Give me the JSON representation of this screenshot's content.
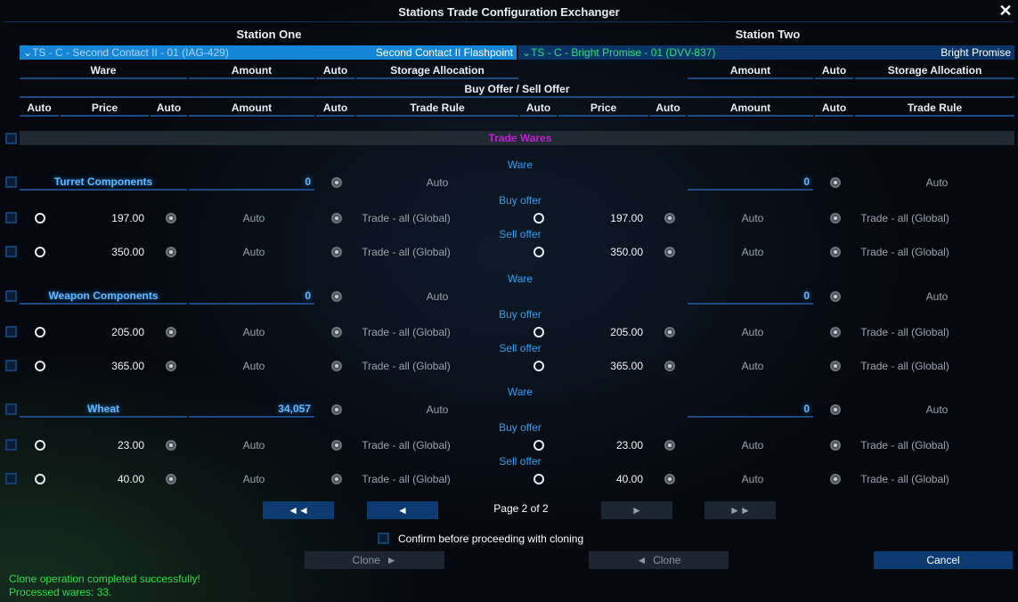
{
  "title": "Stations Trade Configuration Exchanger",
  "close_label": "✕",
  "station_one": {
    "header": "Station One",
    "selected": "TS - C - Second Contact II - 01 (IAG-429)",
    "selected_right": "Second Contact II Flashpoint"
  },
  "station_two": {
    "header": "Station Two",
    "selected": "TS - C - Bright Promise - 01 (DVV-837)",
    "selected_right": "Bright Promise"
  },
  "columns": {
    "ware": "Ware",
    "amount": "Amount",
    "auto": "Auto",
    "storage_allocation": "Storage Allocation",
    "buy_sell_offer": "Buy Offer / Sell Offer",
    "price": "Price",
    "trade_rule": "Trade Rule"
  },
  "trade_wares_label": "Trade Wares",
  "section_labels": {
    "ware": "Ware",
    "buy_offer": "Buy offer",
    "sell_offer": "Sell offer"
  },
  "common": {
    "auto": "Auto",
    "trade_rule": "Trade - all (Global)"
  },
  "wares": [
    {
      "name": "Turret Components",
      "amount_left": "0",
      "amount_right": "0",
      "buy_price_left": "197.00",
      "buy_price_right": "197.00",
      "sell_price_left": "350.00",
      "sell_price_right": "350.00"
    },
    {
      "name": "Weapon Components",
      "amount_left": "0",
      "amount_right": "0",
      "buy_price_left": "205.00",
      "buy_price_right": "205.00",
      "sell_price_left": "365.00",
      "sell_price_right": "365.00"
    },
    {
      "name": "Wheat",
      "amount_left": "34,057",
      "amount_right": "0",
      "buy_price_left": "23.00",
      "buy_price_right": "23.00",
      "sell_price_left": "40.00",
      "sell_price_right": "40.00"
    }
  ],
  "pagination": {
    "page_label": "Page 2 of 2",
    "first_icon": "◄◄",
    "prev_icon": "◄",
    "next_icon": "►",
    "last_icon": "►►"
  },
  "confirm_label": "Confirm before proceeding with cloning",
  "clone_right_label": "Clone",
  "clone_left_label": "Clone",
  "cancel_label": "Cancel",
  "status": {
    "line1": "Clone operation completed successfully!",
    "line2": "Processed wares: 33."
  },
  "colors": {
    "accent": "#1586d6",
    "ware_text": "#63b9ff",
    "trade_wares": "#c01fd0",
    "success": "#25e048",
    "station_two_text": "#22e57a"
  }
}
